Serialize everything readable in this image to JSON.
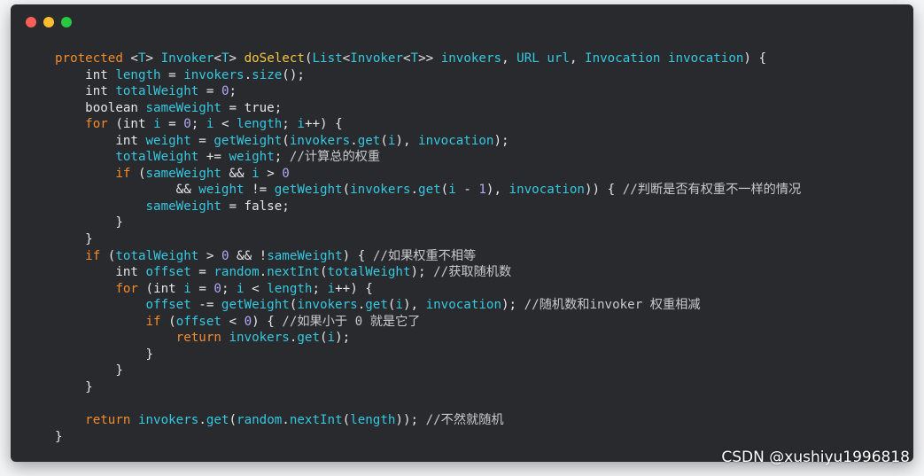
{
  "window": {
    "controls": {
      "close": "red",
      "minimize": "yellow",
      "maximize": "green"
    }
  },
  "code_lines": [
    [
      [
        "k",
        "protected"
      ],
      [
        "o",
        " <"
      ],
      [
        "v",
        "T"
      ],
      [
        "o",
        "> "
      ],
      [
        "v",
        "Invoker"
      ],
      [
        "o",
        "<"
      ],
      [
        "v",
        "T"
      ],
      [
        "o",
        "> "
      ],
      [
        "f",
        "doSelect"
      ],
      [
        "o",
        "("
      ],
      [
        "v",
        "List"
      ],
      [
        "o",
        "<"
      ],
      [
        "v",
        "Invoker"
      ],
      [
        "o",
        "<"
      ],
      [
        "v",
        "T"
      ],
      [
        "o",
        ">> "
      ],
      [
        "v",
        "invokers"
      ],
      [
        "o",
        ", "
      ],
      [
        "v",
        "URL url"
      ],
      [
        "o",
        ", "
      ],
      [
        "v",
        "Invocation invocation"
      ],
      [
        "o",
        ") {"
      ]
    ],
    [
      [
        "o",
        "    "
      ],
      [
        "t",
        "int"
      ],
      [
        "o",
        " "
      ],
      [
        "v",
        "length"
      ],
      [
        "o",
        " = "
      ],
      [
        "v",
        "invokers"
      ],
      [
        "o",
        "."
      ],
      [
        "v",
        "size"
      ],
      [
        "o",
        "();"
      ]
    ],
    [
      [
        "o",
        "    "
      ],
      [
        "t",
        "int"
      ],
      [
        "o",
        " "
      ],
      [
        "v",
        "totalWeight"
      ],
      [
        "o",
        " = "
      ],
      [
        "n",
        "0"
      ],
      [
        "o",
        ";"
      ]
    ],
    [
      [
        "o",
        "    "
      ],
      [
        "t",
        "boolean"
      ],
      [
        "o",
        " "
      ],
      [
        "v",
        "sameWeight"
      ],
      [
        "o",
        " = "
      ],
      [
        "t",
        "true"
      ],
      [
        "o",
        ";"
      ]
    ],
    [
      [
        "o",
        "    "
      ],
      [
        "k",
        "for"
      ],
      [
        "o",
        " ("
      ],
      [
        "t",
        "int"
      ],
      [
        "o",
        " "
      ],
      [
        "v",
        "i"
      ],
      [
        "o",
        " = "
      ],
      [
        "n",
        "0"
      ],
      [
        "o",
        "; "
      ],
      [
        "v",
        "i"
      ],
      [
        "o",
        " < "
      ],
      [
        "v",
        "length"
      ],
      [
        "o",
        "; "
      ],
      [
        "v",
        "i"
      ],
      [
        "o",
        "++) {"
      ]
    ],
    [
      [
        "o",
        "        "
      ],
      [
        "t",
        "int"
      ],
      [
        "o",
        " "
      ],
      [
        "v",
        "weight"
      ],
      [
        "o",
        " = "
      ],
      [
        "v",
        "getWeight"
      ],
      [
        "o",
        "("
      ],
      [
        "v",
        "invokers"
      ],
      [
        "o",
        "."
      ],
      [
        "v",
        "get"
      ],
      [
        "o",
        "("
      ],
      [
        "v",
        "i"
      ],
      [
        "o",
        "), "
      ],
      [
        "v",
        "invocation"
      ],
      [
        "o",
        ");"
      ]
    ],
    [
      [
        "o",
        "        "
      ],
      [
        "v",
        "totalWeight"
      ],
      [
        "o",
        " += "
      ],
      [
        "v",
        "weight"
      ],
      [
        "o",
        "; "
      ],
      [
        "c",
        "//计算总的权重"
      ]
    ],
    [
      [
        "o",
        "        "
      ],
      [
        "k",
        "if"
      ],
      [
        "o",
        " ("
      ],
      [
        "v",
        "sameWeight"
      ],
      [
        "o",
        " && "
      ],
      [
        "v",
        "i"
      ],
      [
        "o",
        " > "
      ],
      [
        "n",
        "0"
      ]
    ],
    [
      [
        "o",
        "                && "
      ],
      [
        "v",
        "weight"
      ],
      [
        "o",
        " != "
      ],
      [
        "v",
        "getWeight"
      ],
      [
        "o",
        "("
      ],
      [
        "v",
        "invokers"
      ],
      [
        "o",
        "."
      ],
      [
        "v",
        "get"
      ],
      [
        "o",
        "("
      ],
      [
        "v",
        "i"
      ],
      [
        "o",
        " - "
      ],
      [
        "n",
        "1"
      ],
      [
        "o",
        "), "
      ],
      [
        "v",
        "invocation"
      ],
      [
        "o",
        ")) { "
      ],
      [
        "c",
        "//判断是否有权重不一样的情况"
      ]
    ],
    [
      [
        "o",
        "            "
      ],
      [
        "v",
        "sameWeight"
      ],
      [
        "o",
        " = "
      ],
      [
        "t",
        "false"
      ],
      [
        "o",
        ";"
      ]
    ],
    [
      [
        "o",
        "        }"
      ]
    ],
    [
      [
        "o",
        "    }"
      ]
    ],
    [
      [
        "o",
        "    "
      ],
      [
        "k",
        "if"
      ],
      [
        "o",
        " ("
      ],
      [
        "v",
        "totalWeight"
      ],
      [
        "o",
        " > "
      ],
      [
        "n",
        "0"
      ],
      [
        "o",
        " && !"
      ],
      [
        "v",
        "sameWeight"
      ],
      [
        "o",
        ") { "
      ],
      [
        "c",
        "//如果权重不相等"
      ]
    ],
    [
      [
        "o",
        "        "
      ],
      [
        "t",
        "int"
      ],
      [
        "o",
        " "
      ],
      [
        "v",
        "offset"
      ],
      [
        "o",
        " = "
      ],
      [
        "v",
        "random"
      ],
      [
        "o",
        "."
      ],
      [
        "v",
        "nextInt"
      ],
      [
        "o",
        "("
      ],
      [
        "v",
        "totalWeight"
      ],
      [
        "o",
        "); "
      ],
      [
        "c",
        "//获取随机数"
      ]
    ],
    [
      [
        "o",
        "        "
      ],
      [
        "k",
        "for"
      ],
      [
        "o",
        " ("
      ],
      [
        "t",
        "int"
      ],
      [
        "o",
        " "
      ],
      [
        "v",
        "i"
      ],
      [
        "o",
        " = "
      ],
      [
        "n",
        "0"
      ],
      [
        "o",
        "; "
      ],
      [
        "v",
        "i"
      ],
      [
        "o",
        " < "
      ],
      [
        "v",
        "length"
      ],
      [
        "o",
        "; "
      ],
      [
        "v",
        "i"
      ],
      [
        "o",
        "++) {"
      ]
    ],
    [
      [
        "o",
        "            "
      ],
      [
        "v",
        "offset"
      ],
      [
        "o",
        " -= "
      ],
      [
        "v",
        "getWeight"
      ],
      [
        "o",
        "("
      ],
      [
        "v",
        "invokers"
      ],
      [
        "o",
        "."
      ],
      [
        "v",
        "get"
      ],
      [
        "o",
        "("
      ],
      [
        "v",
        "i"
      ],
      [
        "o",
        "), "
      ],
      [
        "v",
        "invocation"
      ],
      [
        "o",
        "); "
      ],
      [
        "c",
        "//随机数和invoker 权重相减"
      ]
    ],
    [
      [
        "o",
        "            "
      ],
      [
        "k",
        "if"
      ],
      [
        "o",
        " ("
      ],
      [
        "v",
        "offset"
      ],
      [
        "o",
        " < "
      ],
      [
        "n",
        "0"
      ],
      [
        "o",
        ") { "
      ],
      [
        "c",
        "//如果小于 0 就是它了"
      ]
    ],
    [
      [
        "o",
        "                "
      ],
      [
        "k",
        "return"
      ],
      [
        "o",
        " "
      ],
      [
        "v",
        "invokers"
      ],
      [
        "o",
        "."
      ],
      [
        "v",
        "get"
      ],
      [
        "o",
        "("
      ],
      [
        "v",
        "i"
      ],
      [
        "o",
        ");"
      ]
    ],
    [
      [
        "o",
        "            }"
      ]
    ],
    [
      [
        "o",
        "        }"
      ]
    ],
    [
      [
        "o",
        "    }"
      ]
    ],
    [
      [
        "o",
        ""
      ]
    ],
    [
      [
        "o",
        "    "
      ],
      [
        "k",
        "return"
      ],
      [
        "o",
        " "
      ],
      [
        "v",
        "invokers"
      ],
      [
        "o",
        "."
      ],
      [
        "v",
        "get"
      ],
      [
        "o",
        "("
      ],
      [
        "v",
        "random"
      ],
      [
        "o",
        "."
      ],
      [
        "v",
        "nextInt"
      ],
      [
        "o",
        "("
      ],
      [
        "v",
        "length"
      ],
      [
        "o",
        ")); "
      ],
      [
        "c",
        "//不然就随机"
      ]
    ],
    [
      [
        "o",
        "}"
      ]
    ]
  ],
  "watermark": "CSDN @xushiyu1996818"
}
